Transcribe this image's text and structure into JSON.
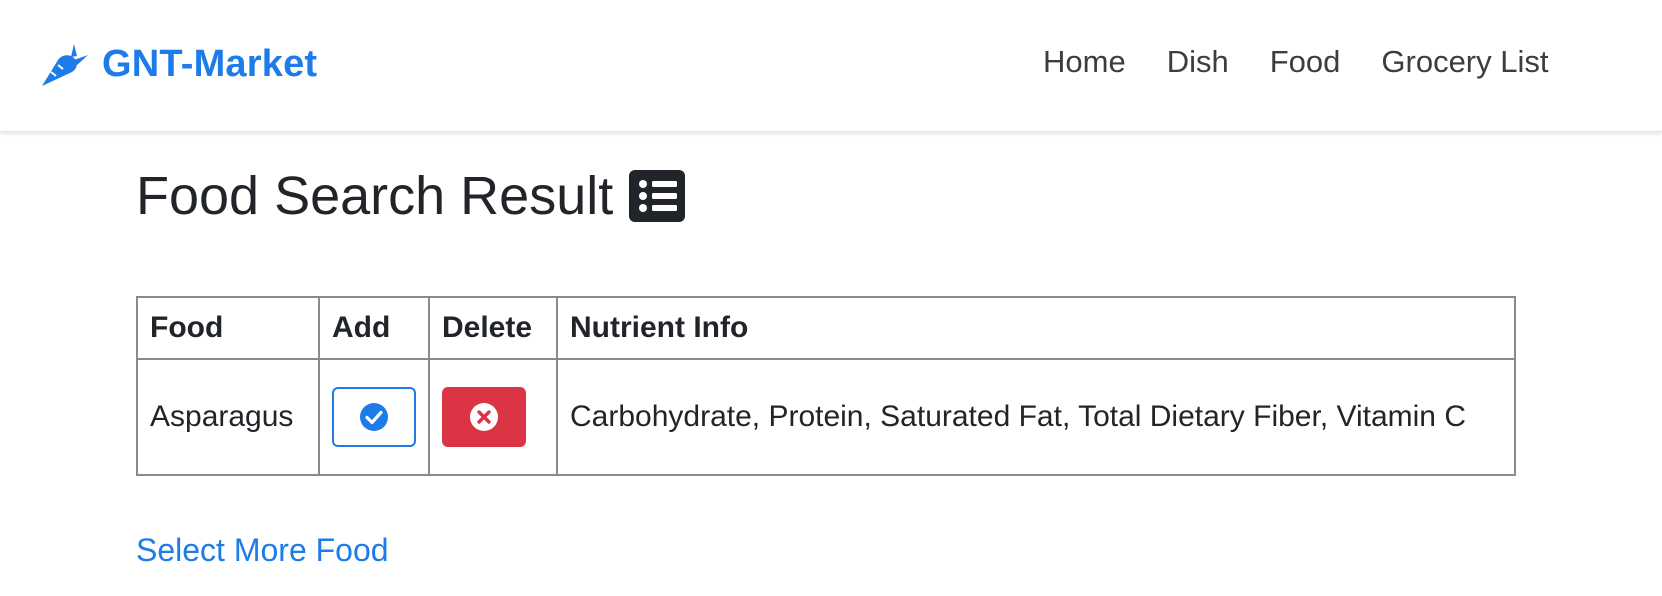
{
  "colors": {
    "primary": "#1d7bea",
    "danger": "#db3545",
    "text": "#212529",
    "nav_text": "#3d3d3d"
  },
  "navbar": {
    "brand": "GNT-Market",
    "brand_icon": "carrot-icon",
    "links": [
      "Home",
      "Dish",
      "Food",
      "Grocery List"
    ]
  },
  "page": {
    "title": "Food Search Result",
    "title_icon": "list-icon"
  },
  "table": {
    "headers": [
      "Food",
      "Add",
      "Delete",
      "Nutrient Info"
    ],
    "rows": [
      {
        "food": "Asparagus",
        "add_icon": "check-circle-icon",
        "delete_icon": "times-circle-icon",
        "nutrients": "Carbohydrate, Protein, Saturated Fat, Total Dietary Fiber, Vitamin C"
      }
    ]
  },
  "footer_link": "Select More Food"
}
